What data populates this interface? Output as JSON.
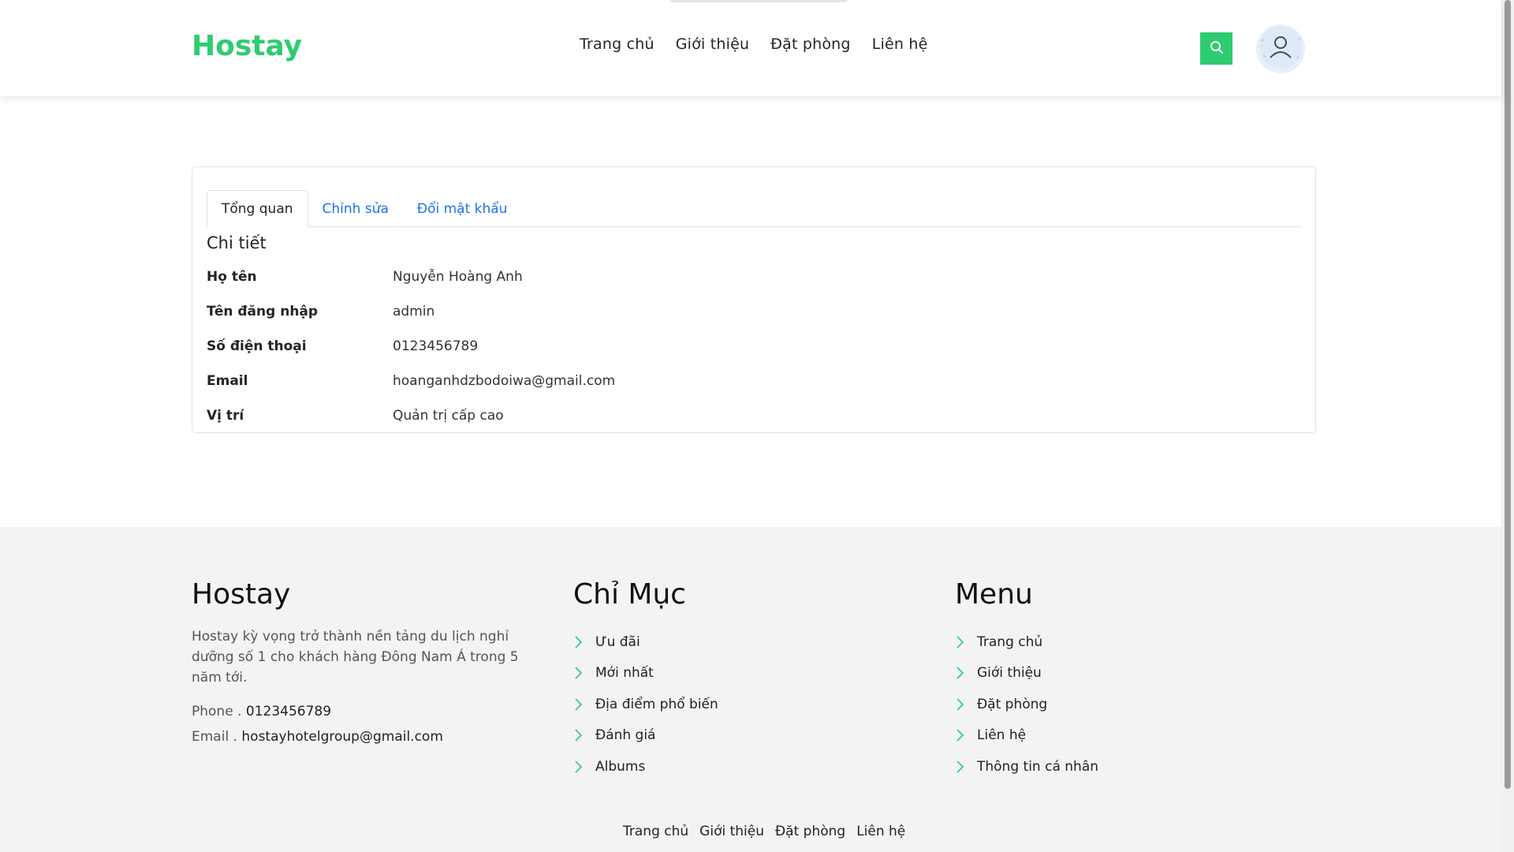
{
  "header": {
    "logo": "Hostay",
    "nav": [
      "Trang chủ",
      "Giới thiệu",
      "Đặt phòng",
      "Liên hệ"
    ],
    "search_icon": "search-icon",
    "avatar_icon": "user-avatar-icon"
  },
  "profile": {
    "tabs": [
      "Tổng quan",
      "Chỉnh sửa",
      "Đổi mật khẩu"
    ],
    "active_tab": "Tổng quan",
    "section_title": "Chi tiết",
    "fields": [
      {
        "label": "Họ tên",
        "value": "Nguyễn Hoàng Anh"
      },
      {
        "label": "Tên đăng nhập",
        "value": "admin"
      },
      {
        "label": "Số điện thoại",
        "value": "0123456789"
      },
      {
        "label": "Email",
        "value": "hoanganhdzbodoiwa@gmail.com"
      },
      {
        "label": "Vị trí",
        "value": "Quản trị cấp cao"
      }
    ]
  },
  "footer": {
    "about": {
      "title": "Hostay",
      "description": "Hostay kỳ vọng trở thành nền tảng du lịch nghỉ dưỡng số 1 cho khách hàng Đông Nam Á trong 5 năm tới.",
      "phone_label": "Phone . ",
      "phone": "0123456789",
      "email_label": "Email . ",
      "email": "hostayhotelgroup@gmail.com"
    },
    "index": {
      "title": "Chỉ Mục",
      "items": [
        "Ưu đãi",
        "Mới nhất",
        "Địa điểm phổ biến",
        "Đánh giá",
        "Albums"
      ]
    },
    "menu": {
      "title": "Menu",
      "items": [
        "Trang chủ",
        "Giới thiệu",
        "Đặt phòng",
        "Liên hệ",
        "Thông tin cá nhân"
      ]
    },
    "bottom_links": [
      "Trang chủ",
      "Giới thiệu",
      "Đặt phòng",
      "Liên hệ"
    ]
  },
  "colors": {
    "brand": "#2ecc71",
    "link": "#1e73e8"
  }
}
